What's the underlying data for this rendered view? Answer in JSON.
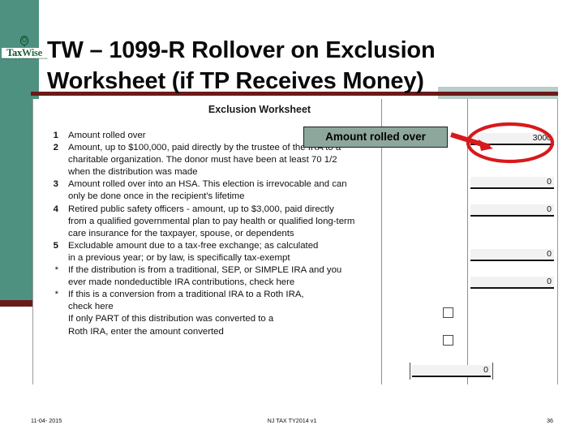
{
  "slide": {
    "title_lines": [
      "TW – 1099-R Rollover on Exclusion",
      "Worksheet (if TP Receives Money)"
    ],
    "logo": {
      "word_tax": "Tax",
      "word_wise": "Wise",
      "tagline": "Software by the Tax Professionals of America"
    }
  },
  "worksheet": {
    "heading": "Exclusion Worksheet",
    "rows": [
      {
        "num": "1",
        "lines": [
          "Amount rolled over"
        ]
      },
      {
        "num": "2",
        "lines": [
          "Amount,  up to $100,000,  paid directly by the trustee of the IRA to a",
          "charitable organization.  The donor must have been at least 70 1/2",
          "when the distribution was made"
        ]
      },
      {
        "num": "3",
        "lines": [
          "Amount rolled over into an HSA.  This election is irrevocable and can",
          "only be done once in the recipient's lifetime"
        ]
      },
      {
        "num": "4",
        "lines": [
          "Retired public safety officers - amount,  up to $3,000,  paid directly",
          "from a qualified governmental plan to pay health or qualified long-term",
          "care insurance for the taxpayer,  spouse,  or dependents"
        ]
      },
      {
        "num": "5",
        "lines": [
          "Excludable amount due to a tax-free exchange;  as calculated",
          "in a previous year;  or by law,  is specifically tax-exempt"
        ]
      },
      {
        "num": "*",
        "lines": [
          "If the distribution is from a traditional,  SEP,  or SIMPLE IRA and you",
          "ever made nondeductible IRA contributions,  check here"
        ]
      },
      {
        "num": "*",
        "lines": [
          "If this is a conversion from a traditional IRA to a Roth IRA,",
          "check here"
        ]
      },
      {
        "num": "",
        "lines": [
          "If only PART of this distribution was converted to a",
          "Roth IRA,  enter the amount converted"
        ]
      }
    ],
    "fields": {
      "line1_value": "3000",
      "line3_value": "0",
      "line4_value": "0",
      "line5_value": "0",
      "line6_value": "0",
      "converted_amount_value": "0"
    },
    "checkboxes": {
      "nondeductible_ira_checked": false,
      "roth_conversion_checked": false
    }
  },
  "annotation": {
    "callout_label": "Amount rolled over",
    "callout_bg": "#8EA79C",
    "highlight_color": "#D8191C",
    "arrow_color": "#D8191C"
  },
  "footer": {
    "date": "11-04- 2015",
    "center": "NJ TAX TY2014 v1",
    "page": "36"
  },
  "theme": {
    "accent_teal": "#4E9180",
    "accent_dark_red": "#6B1A1A",
    "light_teal": "#B9CDC9"
  }
}
